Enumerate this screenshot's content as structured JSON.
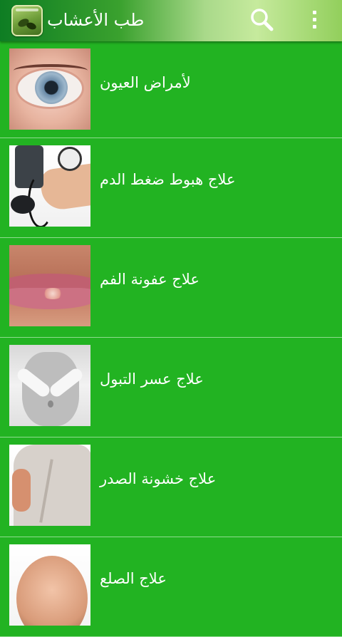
{
  "app_bar": {
    "title": "طب الأعشاب",
    "icons": {
      "app": "herbs-app-icon",
      "search": "search-icon",
      "overflow": "overflow-menu-icon"
    },
    "colors": {
      "bar_dark": "#0e7d23",
      "bar_light": "#c6ea9d"
    }
  },
  "list": {
    "background": "#22b322",
    "divider": "#8fdc8f",
    "items": [
      {
        "label": "لأمراض العيون",
        "thumbnail": "eye-thumbnail"
      },
      {
        "label": "علاج هبوط ضغط الدم",
        "thumbnail": "blood-pressure-thumbnail"
      },
      {
        "label": "علاج عفونة الفم",
        "thumbnail": "mouth-thumbnail"
      },
      {
        "label": "علاج عسر التبول",
        "thumbnail": "abdomen-thumbnail"
      },
      {
        "label": "علاج خشونة الصدر",
        "thumbnail": "chest-thumbnail"
      },
      {
        "label": "علاج الصلع",
        "thumbnail": "scalp-thumbnail"
      }
    ]
  }
}
